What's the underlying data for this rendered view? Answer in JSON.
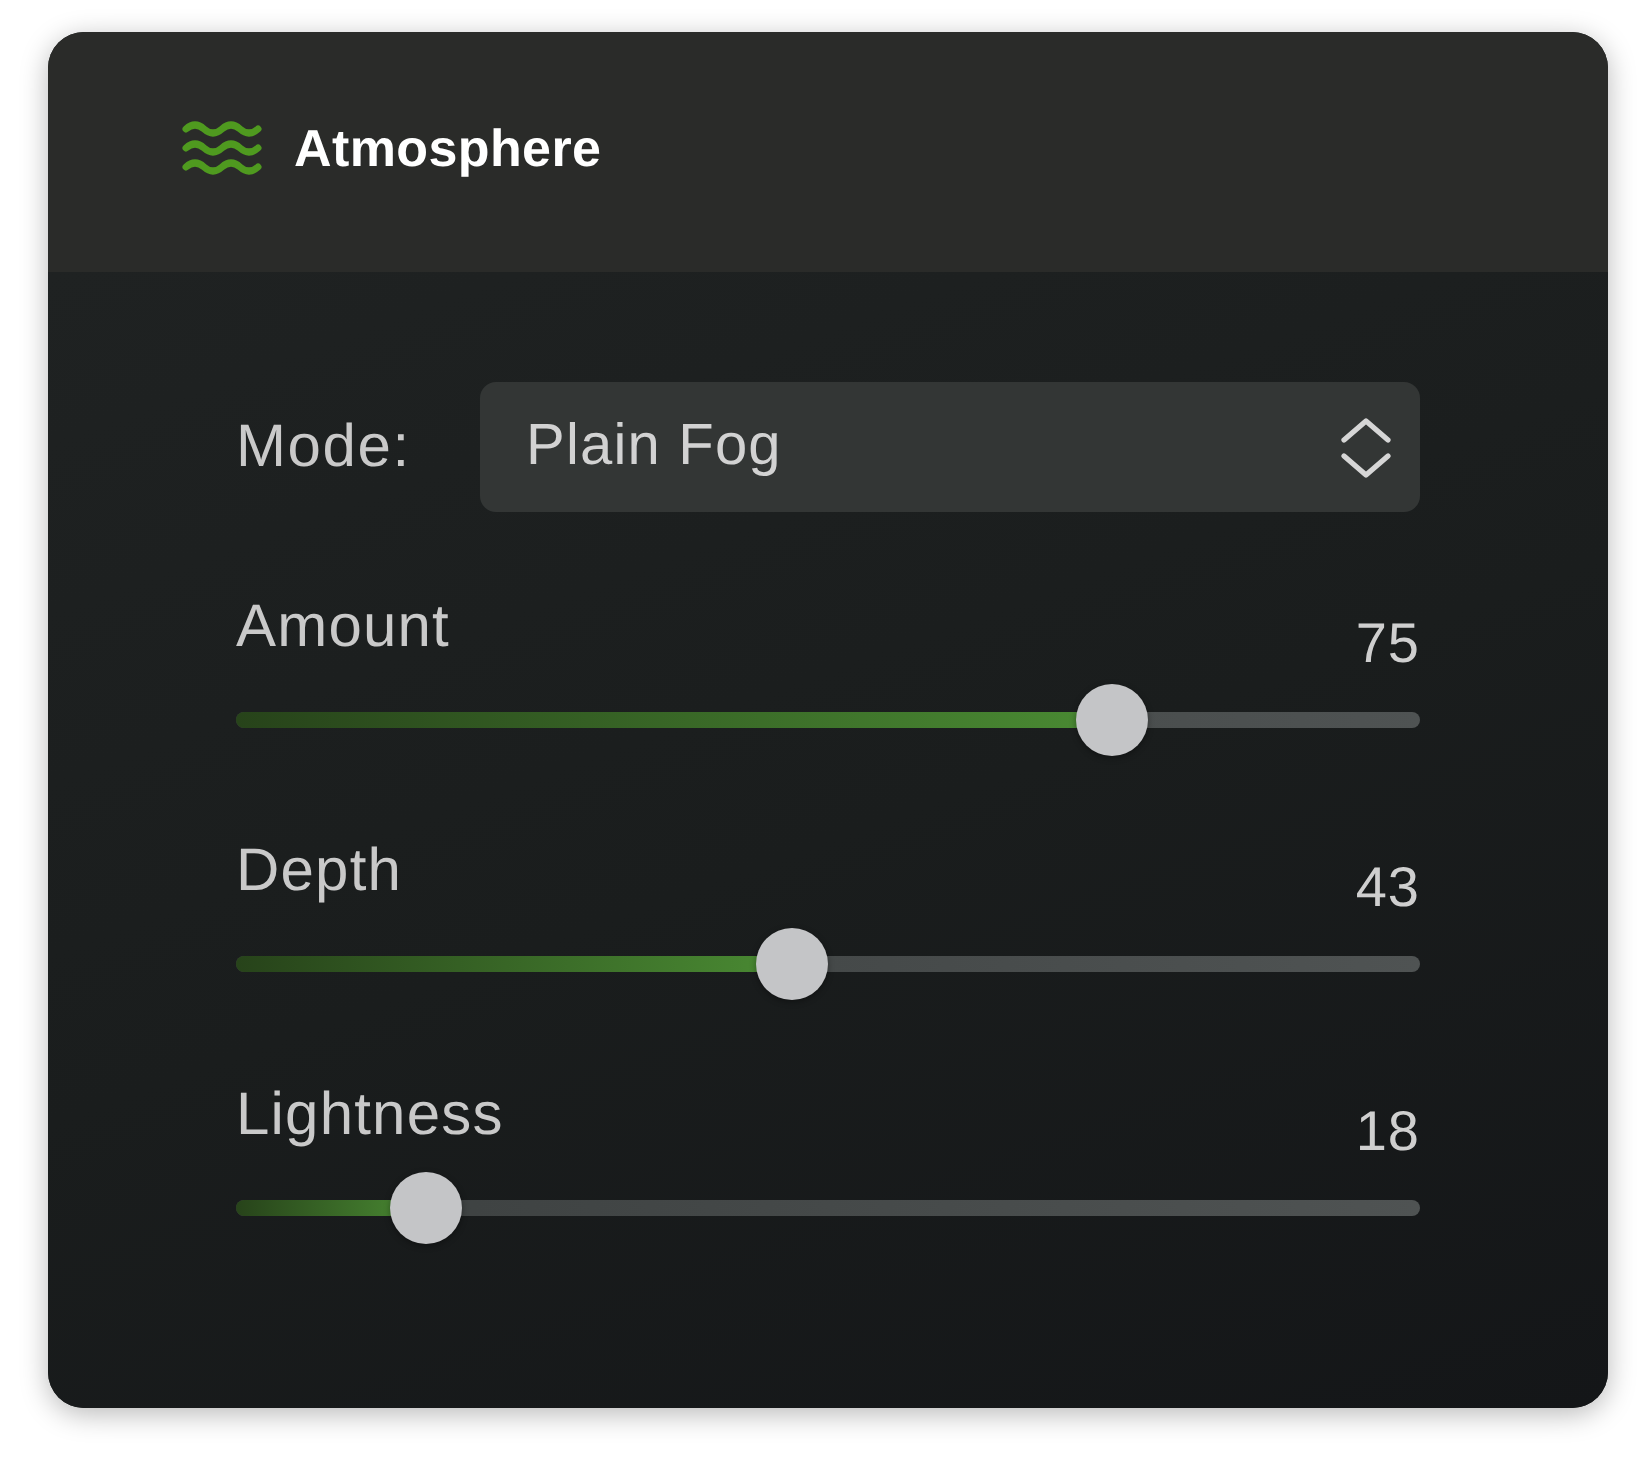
{
  "panel": {
    "title": "Atmosphere"
  },
  "mode": {
    "label": "Mode:",
    "value": "Plain Fog"
  },
  "sliders": [
    {
      "label": "Amount",
      "value": "75",
      "level": 0.74
    },
    {
      "label": "Depth",
      "value": "43",
      "level": 0.47
    },
    {
      "label": "Lightness",
      "value": "18",
      "level": 0.16
    }
  ]
}
